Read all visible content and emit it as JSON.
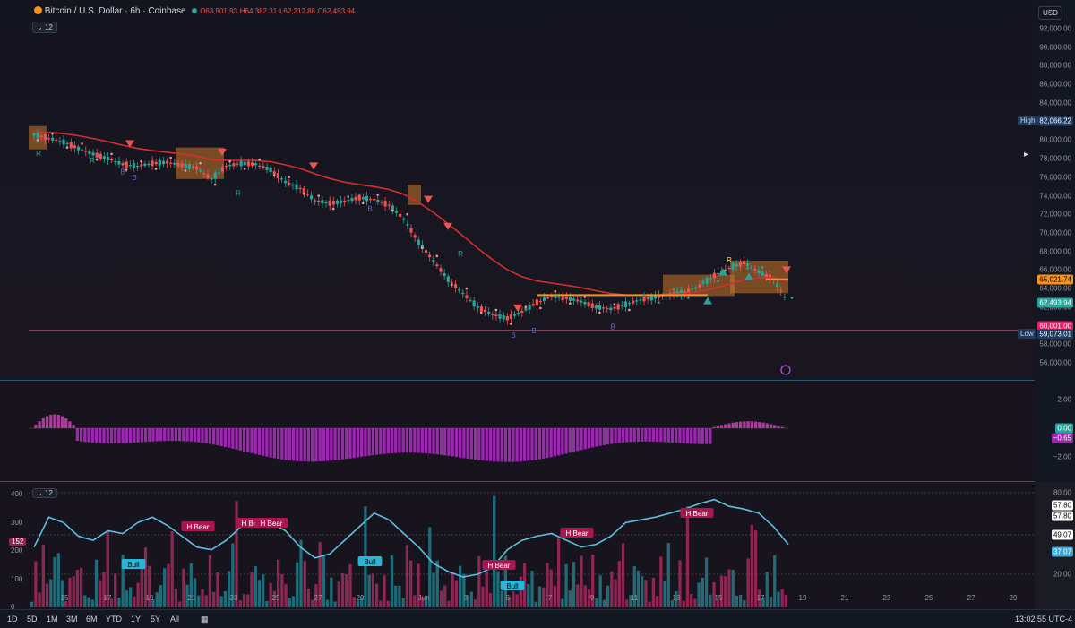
{
  "legend": {
    "symbol": "Bitcoin / U.S. Dollar · 6h · Coinbase",
    "open": "O63,901.93",
    "high": "H64,382.31",
    "low": "L62,212.88",
    "close": "C62,493.94",
    "indicator_count": "12"
  },
  "currency": "USD",
  "price_axis": [
    "92,000.00",
    "90,000.00",
    "88,000.00",
    "86,000.00",
    "84,000.00",
    "82,000.00",
    "80,000.00",
    "78,000.00",
    "76,000.00",
    "74,000.00",
    "72,000.00",
    "70,000.00",
    "68,000.00",
    "66,000.00",
    "64,000.00",
    "62,000.00",
    "60,000.00",
    "58,000.00",
    "56,000.00"
  ],
  "price_tags": {
    "high_label": "High",
    "high_value": "82,066.22",
    "orange_value": "65,021.74",
    "last_value": "62,493.94",
    "line_value": "60,001.00",
    "low_label": "Low",
    "low_value": "59,073.01"
  },
  "osc_axis": {
    "top": "2.00",
    "bottom": "−2.00",
    "green": "0.00",
    "pink": "−0.65"
  },
  "vol_axis": {
    "left": [
      "400",
      "300",
      "200",
      "100",
      "0"
    ],
    "left_tag": "152",
    "right": [
      "80.00",
      "57.80",
      "57.80",
      "49.07",
      "37.07",
      "20.00"
    ],
    "right_labels": [
      "80.00",
      "20.00"
    ],
    "tags": [
      "57.80",
      "57.80",
      "49.07",
      "37.07"
    ]
  },
  "annotations": {
    "h_bear": "H Bear",
    "bull": "Bull",
    "r": "R",
    "b": "B"
  },
  "x_axis": [
    "15",
    "17",
    "19",
    "21",
    "23",
    "25",
    "27",
    "29",
    "Jun",
    "3",
    "5",
    "7",
    "9",
    "11",
    "13",
    "15",
    "17",
    "19",
    "21",
    "23",
    "25",
    "27",
    "29"
  ],
  "timeframes": [
    "1D",
    "5D",
    "1M",
    "3M",
    "6M",
    "YTD",
    "1Y",
    "5Y",
    "All"
  ],
  "clock": "13:02:55 UTC-4",
  "colors": {
    "up": "#26a69a",
    "down": "#ef5350",
    "ema": "#d32f2f",
    "orange": "#f7931a",
    "purple": "#9c27b0",
    "cyan": "#4dd0e1"
  },
  "chart_data": {
    "type": "candlestick",
    "series": [
      {
        "name": "price_close_approx",
        "values": [
          80600,
          80200,
          79800,
          79100,
          78500,
          78000,
          77400,
          77200,
          77500,
          77600,
          77300,
          77000,
          75800,
          77200,
          77500,
          77400,
          76800,
          75500,
          74800,
          73500,
          73200,
          73400,
          73800,
          73600,
          73000,
          71500,
          69000,
          67000,
          65000,
          63500,
          62000,
          61200,
          60800,
          61500,
          62500,
          63200,
          63000,
          62600,
          62000,
          61800,
          62300,
          62800,
          63100,
          63400,
          63600,
          64300,
          65400,
          66200,
          66800,
          65800,
          65000,
          62494
        ]
      }
    ]
  }
}
